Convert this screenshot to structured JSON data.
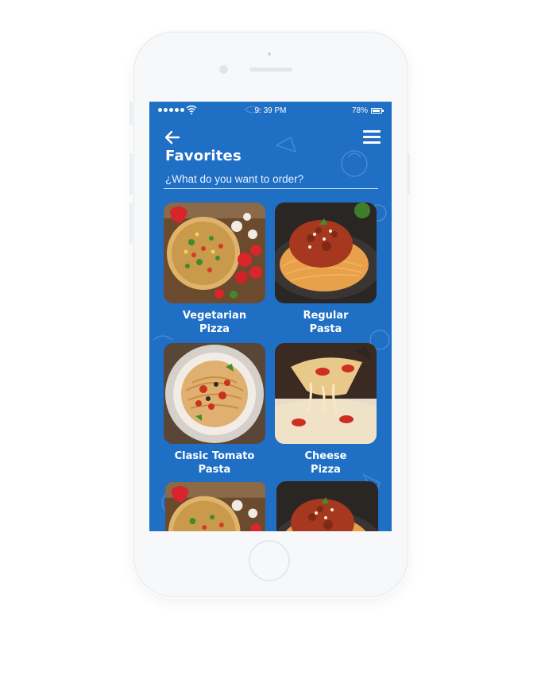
{
  "status_bar": {
    "time": "9: 39 PM",
    "battery": "78%"
  },
  "header": {
    "title": "Favorites"
  },
  "search": {
    "placeholder": "¿What do you want to order?"
  },
  "items": [
    {
      "name_line1": "Vegetarian",
      "name_line2": "Pizza",
      "image": "vegetarian-pizza"
    },
    {
      "name_line1": "Regular",
      "name_line2": "Pasta",
      "image": "regular-pasta"
    },
    {
      "name_line1": "Clasic Tomato",
      "name_line2": "Pasta",
      "image": "tomato-pasta"
    },
    {
      "name_line1": "Cheese",
      "name_line2": "Pizza",
      "image": "cheese-pizza"
    },
    {
      "image": "vegetarian-pizza"
    },
    {
      "image": "regular-pasta"
    }
  ],
  "colors": {
    "screen_bg": "#1f6fc5",
    "text": "#ffffff"
  }
}
